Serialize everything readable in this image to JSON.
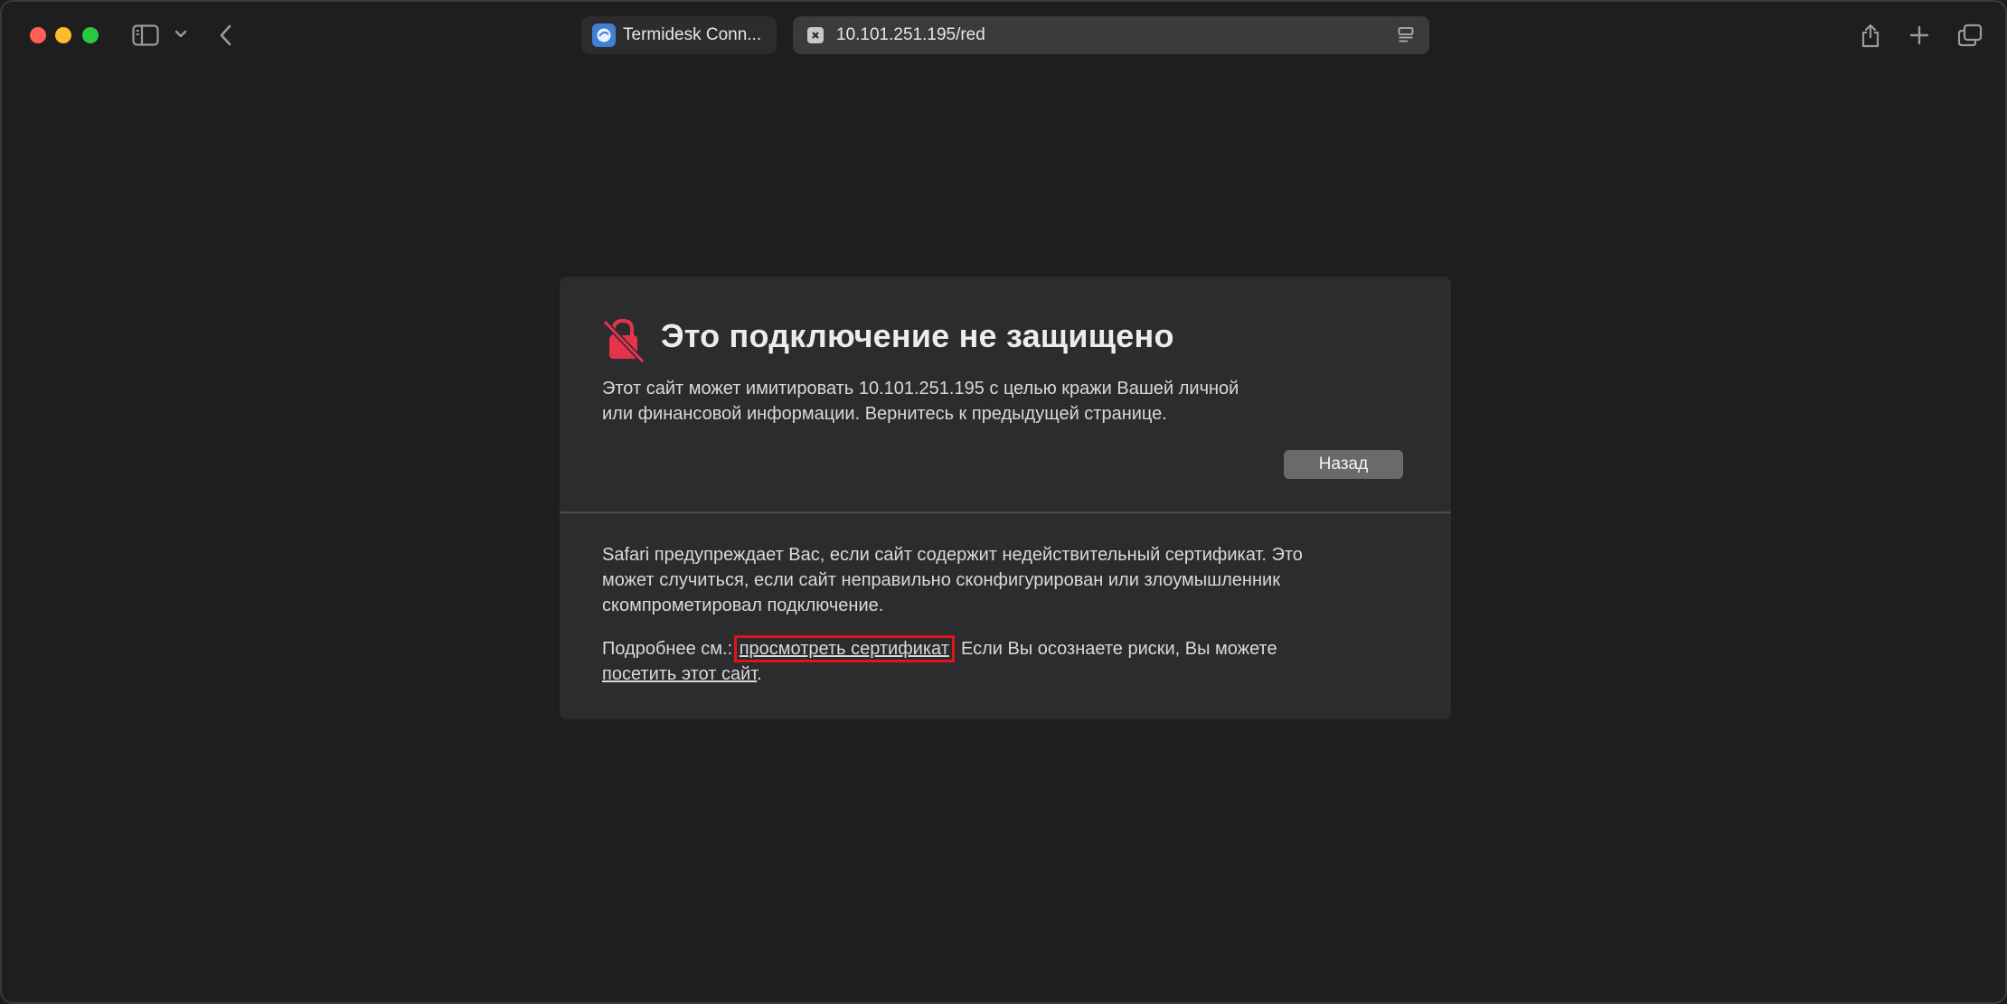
{
  "window": {
    "traffic_lights": {
      "close_color": "#ff5f57",
      "minimize_color": "#febc2e",
      "zoom_color": "#28c840"
    }
  },
  "toolbar": {
    "icons": [
      "sidebar-icon",
      "chevron-down-icon",
      "back-icon",
      "share-icon",
      "plus-icon",
      "tabs-overview-icon"
    ]
  },
  "tabs": [
    {
      "label": "Termidesk Conn...",
      "active": false,
      "icon": "termidesk-favicon"
    },
    {
      "label": "10.101.251.195/red",
      "active": true,
      "icon": "close-x-icon"
    }
  ],
  "warning": {
    "title": "Это подключение не защищено",
    "lead_line1": "Этот сайт может имитировать 10.101.251.195 с целью кражи Вашей личной",
    "lead_line2": "или финансовой информации. Вернитесь к предыдущей странице.",
    "back_button": "Назад",
    "detail_line1": "Safari предупреждает Вас, если сайт содержит недействительный сертификат. Это",
    "detail_line2": "может случиться, если сайт неправильно сконфигурирован или злоумышленник",
    "detail_line3": "скомпрометировал подключение.",
    "more_prefix": "Подробнее см.: ",
    "view_certificate_link": "просмотреть сертификат",
    "more_middle": ". Если Вы осознаете риски, Вы можете",
    "visit_site_link": "посетить этот сайт",
    "more_suffix": ".",
    "icon_color": "#e5334b",
    "highlight_color": "#e0141e"
  }
}
